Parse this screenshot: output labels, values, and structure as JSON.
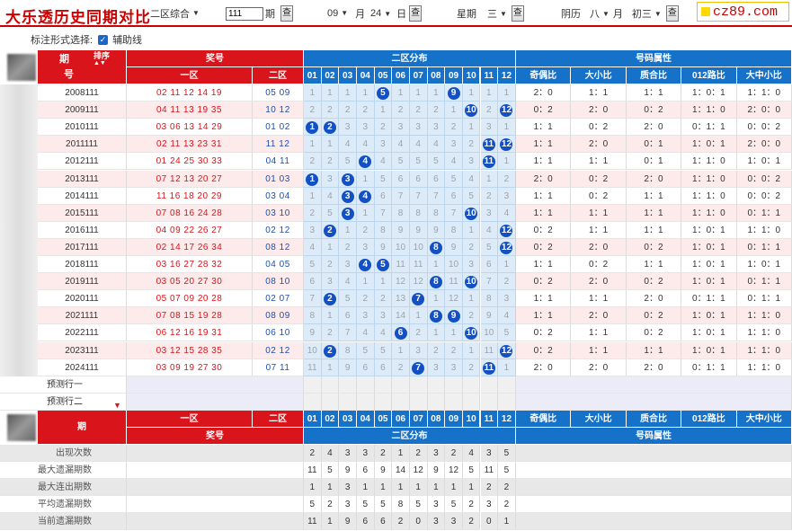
{
  "header": {
    "title": "大乐透历史同期对比",
    "zone_select": "二区综合",
    "period_input": "111",
    "period_suffix": "期",
    "month_value": "09",
    "month_suffix": "月",
    "day_value": "24",
    "day_suffix": "日",
    "weekday_label": "星期",
    "weekday_value": "三",
    "lunar_label": "阴历",
    "lunar_month": "八",
    "lunar_month_suffix": "月",
    "lunar_day": "初三",
    "query_label": "查",
    "brand": "cz89.com"
  },
  "options": {
    "label": "标注形式选择:",
    "checkbox_label": "辅助线",
    "checked": true
  },
  "table": {
    "col_period_top": "期",
    "col_period_bottom": "号",
    "col_sort": "排序",
    "col_prize": "奖号",
    "col_zone1": "一区",
    "col_zone2": "二区",
    "col_dist": "二区分布",
    "col_attr": "号码属性",
    "dist_nums": [
      "01",
      "02",
      "03",
      "04",
      "05",
      "06",
      "07",
      "08",
      "09",
      "10",
      "11",
      "12"
    ],
    "attr_cols": [
      "奇偶比",
      "大小比",
      "质合比",
      "012路比",
      "大中小比"
    ],
    "rows": [
      {
        "period": "2008111",
        "z1": "02 11 12 14 19",
        "z2": "05 09",
        "dist": [
          "1",
          "1",
          "1",
          "1",
          "5",
          "1",
          "1",
          "1",
          "9",
          "1",
          "1",
          "1"
        ],
        "attr": [
          "2：0",
          "1：1",
          "1：1",
          "1：0：1",
          "1：1：0"
        ]
      },
      {
        "period": "2009111",
        "z1": "04 11 13 19 35",
        "z2": "10 12",
        "dist": [
          "2",
          "2",
          "2",
          "2",
          "1",
          "2",
          "2",
          "2",
          "1",
          "10",
          "2",
          "12"
        ],
        "attr": [
          "0：2",
          "2：0",
          "0：2",
          "1：1：0",
          "2：0：0"
        ]
      },
      {
        "period": "2010111",
        "z1": "03 06 13 14 29",
        "z2": "01 02",
        "dist": [
          "1",
          "2",
          "3",
          "3",
          "2",
          "3",
          "3",
          "3",
          "2",
          "1",
          "3",
          "1"
        ],
        "attr": [
          "1：1",
          "0：2",
          "2：0",
          "0：1：1",
          "0：0：2"
        ]
      },
      {
        "period": "2011111",
        "z1": "02 11 13 23 31",
        "z2": "11 12",
        "dist": [
          "1",
          "1",
          "4",
          "4",
          "3",
          "4",
          "4",
          "4",
          "3",
          "2",
          "11",
          "12"
        ],
        "attr": [
          "1：1",
          "2：0",
          "0：1",
          "1：0：1",
          "2：0：0"
        ]
      },
      {
        "period": "2012111",
        "z1": "01 24 25 30 33",
        "z2": "04 11",
        "dist": [
          "2",
          "2",
          "5",
          "4",
          "4",
          "5",
          "5",
          "5",
          "4",
          "3",
          "11",
          "1"
        ],
        "attr": [
          "1：1",
          "1：1",
          "0：1",
          "1：1：0",
          "1：0：1"
        ]
      },
      {
        "period": "2013111",
        "z1": "07 12 13 20 27",
        "z2": "01 03",
        "dist": [
          "1",
          "3",
          "3",
          "1",
          "5",
          "6",
          "6",
          "6",
          "5",
          "4",
          "1",
          "2"
        ],
        "attr": [
          "2：0",
          "0：2",
          "2：0",
          "1：1：0",
          "0：0：2"
        ]
      },
      {
        "period": "2014111",
        "z1": "11 16 18 20 29",
        "z2": "03 04",
        "dist": [
          "1",
          "4",
          "3",
          "4",
          "6",
          "7",
          "7",
          "7",
          "6",
          "5",
          "2",
          "3"
        ],
        "attr": [
          "1：1",
          "0：2",
          "1：1",
          "1：1：0",
          "0：0：2"
        ]
      },
      {
        "period": "2015111",
        "z1": "07 08 16 24 28",
        "z2": "03 10",
        "dist": [
          "2",
          "5",
          "3",
          "1",
          "7",
          "8",
          "8",
          "8",
          "7",
          "10",
          "3",
          "4"
        ],
        "attr": [
          "1：1",
          "1：1",
          "1：1",
          "1：1：0",
          "0：1：1"
        ]
      },
      {
        "period": "2016111",
        "z1": "04 09 22 26 27",
        "z2": "02 12",
        "dist": [
          "3",
          "2",
          "1",
          "2",
          "8",
          "9",
          "9",
          "9",
          "8",
          "1",
          "4",
          "12"
        ],
        "attr": [
          "0：2",
          "1：1",
          "1：1",
          "1：0：1",
          "1：1：0"
        ]
      },
      {
        "period": "2017111",
        "z1": "02 14 17 26 34",
        "z2": "08 12",
        "dist": [
          "4",
          "1",
          "2",
          "3",
          "9",
          "10",
          "10",
          "8",
          "9",
          "2",
          "5",
          "12"
        ],
        "attr": [
          "0：2",
          "2：0",
          "0：2",
          "1：0：1",
          "0：1：1"
        ]
      },
      {
        "period": "2018111",
        "z1": "03 16 27 28 32",
        "z2": "04 05",
        "dist": [
          "5",
          "2",
          "3",
          "4",
          "5",
          "11",
          "11",
          "1",
          "10",
          "3",
          "6",
          "1"
        ],
        "attr": [
          "1：1",
          "0：2",
          "1：1",
          "1：0：1",
          "1：0：1"
        ]
      },
      {
        "period": "2019111",
        "z1": "03 05 20 27 30",
        "z2": "08 10",
        "dist": [
          "6",
          "3",
          "4",
          "1",
          "1",
          "12",
          "12",
          "8",
          "11",
          "10",
          "7",
          "2"
        ],
        "attr": [
          "0：2",
          "2：0",
          "0：2",
          "1：0：1",
          "0：1：1"
        ]
      },
      {
        "period": "2020111",
        "z1": "05 07 09 20 28",
        "z2": "02 07",
        "dist": [
          "7",
          "2",
          "5",
          "2",
          "2",
          "13",
          "7",
          "1",
          "12",
          "1",
          "8",
          "3"
        ],
        "attr": [
          "1：1",
          "1：1",
          "2：0",
          "0：1：1",
          "0：1：1"
        ]
      },
      {
        "period": "2021111",
        "z1": "07 08 15 19 28",
        "z2": "08 09",
        "dist": [
          "8",
          "1",
          "6",
          "3",
          "3",
          "14",
          "1",
          "8",
          "9",
          "2",
          "9",
          "4"
        ],
        "attr": [
          "1：1",
          "2：0",
          "0：2",
          "1：0：1",
          "1：1：0"
        ]
      },
      {
        "period": "2022111",
        "z1": "06 12 16 19 31",
        "z2": "06 10",
        "dist": [
          "9",
          "2",
          "7",
          "4",
          "4",
          "6",
          "2",
          "1",
          "1",
          "10",
          "10",
          "5"
        ],
        "attr": [
          "0：2",
          "1：1",
          "0：2",
          "1：0：1",
          "1：1：0"
        ]
      },
      {
        "period": "2023111",
        "z1": "03 12 15 28 35",
        "z2": "02 12",
        "dist": [
          "10",
          "2",
          "8",
          "5",
          "5",
          "1",
          "3",
          "2",
          "2",
          "1",
          "11",
          "12"
        ],
        "attr": [
          "0：2",
          "1：1",
          "1：1",
          "1：0：1",
          "1：1：0"
        ]
      },
      {
        "period": "2024111",
        "z1": "03 09 19 27 30",
        "z2": "07 11",
        "dist": [
          "11",
          "1",
          "9",
          "6",
          "6",
          "2",
          "7",
          "3",
          "3",
          "2",
          "11",
          "1"
        ],
        "attr": [
          "2：0",
          "2：0",
          "2：0",
          "0：1：1",
          "1：1：0"
        ]
      }
    ],
    "hits": [
      [
        4,
        8
      ],
      [
        9,
        11
      ],
      [
        0,
        1
      ],
      [
        10,
        11
      ],
      [
        3,
        10
      ],
      [
        0,
        2
      ],
      [
        2,
        3
      ],
      [
        2,
        9
      ],
      [
        1,
        11
      ],
      [
        7,
        11
      ],
      [
        3,
        4
      ],
      [
        7,
        9
      ],
      [
        1,
        6
      ],
      [
        7,
        8
      ],
      [
        5,
        9
      ],
      [
        1,
        11
      ],
      [
        6,
        10
      ]
    ],
    "predict_rows": [
      "预测行一",
      "预测行二"
    ],
    "stats": [
      {
        "label": "出现次数",
        "values": [
          "2",
          "4",
          "3",
          "3",
          "2",
          "1",
          "2",
          "3",
          "2",
          "4",
          "3",
          "5"
        ]
      },
      {
        "label": "最大遗漏期数",
        "values": [
          "11",
          "5",
          "9",
          "6",
          "9",
          "14",
          "12",
          "9",
          "12",
          "5",
          "11",
          "5"
        ]
      },
      {
        "label": "最大连出期数",
        "values": [
          "1",
          "1",
          "3",
          "1",
          "1",
          "1",
          "1",
          "1",
          "1",
          "1",
          "2",
          "2"
        ]
      },
      {
        "label": "平均遗漏期数",
        "values": [
          "5",
          "2",
          "3",
          "5",
          "5",
          "8",
          "5",
          "3",
          "5",
          "2",
          "3",
          "2"
        ]
      },
      {
        "label": "当前遗漏期数",
        "values": [
          "11",
          "1",
          "9",
          "6",
          "6",
          "2",
          "0",
          "3",
          "3",
          "2",
          "0",
          "1"
        ]
      }
    ]
  }
}
